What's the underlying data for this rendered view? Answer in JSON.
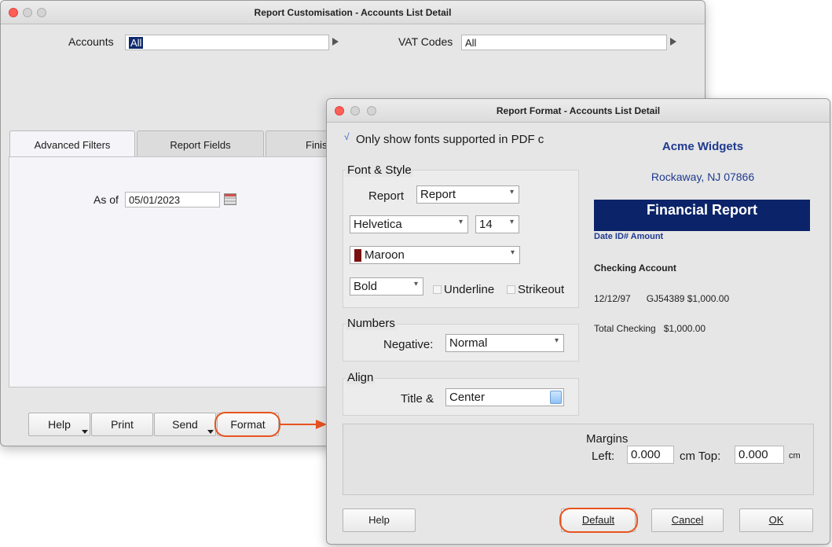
{
  "main_window": {
    "title": "Report Customisation - Accounts List Detail",
    "accounts_label": "Accounts",
    "accounts_value": "All",
    "vat_label": "VAT Codes",
    "vat_value": "All",
    "tabs": [
      "Advanced Filters",
      "Report Fields",
      "Finis"
    ],
    "as_of_label": "As of",
    "as_of_value": "05/01/2023",
    "buttons": {
      "help": "Help",
      "print": "Print",
      "send": "Send",
      "format": "Format"
    }
  },
  "format_dialog": {
    "title": "Report Format - Accounts List Detail",
    "only_pdf_fonts": "Only show fonts supported in PDF c",
    "font_style_title": "Font & Style",
    "report_label": "Report",
    "report_value": "Report",
    "font_value": "Helvetica",
    "size_value": "14",
    "color_value": "Maroon",
    "weight_value": "Bold",
    "underline_label": "Underline",
    "strikeout_label": "Strikeout",
    "numbers_title": "Numbers",
    "negative_label": "Negative:",
    "negative_value": "Normal",
    "align_title": "Align",
    "title_align_label": "Title &",
    "title_align_value": "Center",
    "margins_title": "Margins",
    "left_label": "Left:",
    "left_value": "0.000",
    "cm_top_label": "cm Top:",
    "top_value": "0.000",
    "cm_label": "cm",
    "buttons": {
      "help": "Help",
      "default": "Default",
      "cancel": "Cancel",
      "ok": "OK"
    }
  },
  "preview": {
    "company": "Acme Widgets",
    "location": "Rockaway, NJ 07866",
    "report_title": "Financial Report",
    "columns": "Date  ID# Amount",
    "section": "Checking Account",
    "row": "12/12/97      GJ54389 $1,000.00",
    "total": "Total Checking   $1,000.00"
  },
  "colors": {
    "accent_highlight": "#e8531f",
    "preview_banner": "#0b2469",
    "preview_text": "#1f3a8f",
    "maroon_swatch": "#7a1010"
  }
}
